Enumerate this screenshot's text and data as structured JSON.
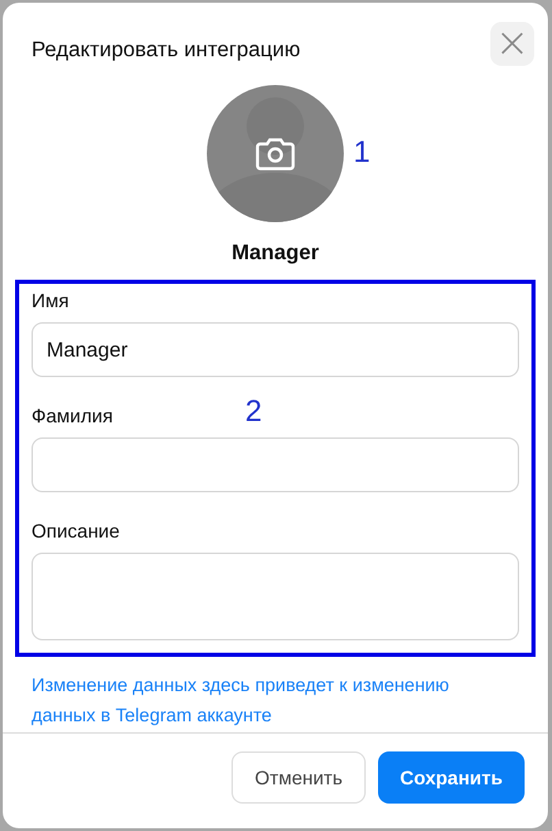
{
  "dialog": {
    "title": "Редактировать интеграцию",
    "close_label": "×"
  },
  "avatar": {
    "name": "Manager",
    "annotation": "1"
  },
  "form": {
    "annotation": "2",
    "fields": [
      {
        "label": "Имя",
        "kind": "input",
        "value": "Manager"
      },
      {
        "label": "Фамилия",
        "kind": "input"
      },
      {
        "label": "Описание",
        "kind": "textarea"
      }
    ]
  },
  "note": "Изменение данных здесь приведет к изменению данных в Telegram аккаунте",
  "buttons": [
    {
      "label": "Отменить",
      "kind": "secondary"
    },
    {
      "label": "Сохранить",
      "kind": "primary"
    }
  ]
}
